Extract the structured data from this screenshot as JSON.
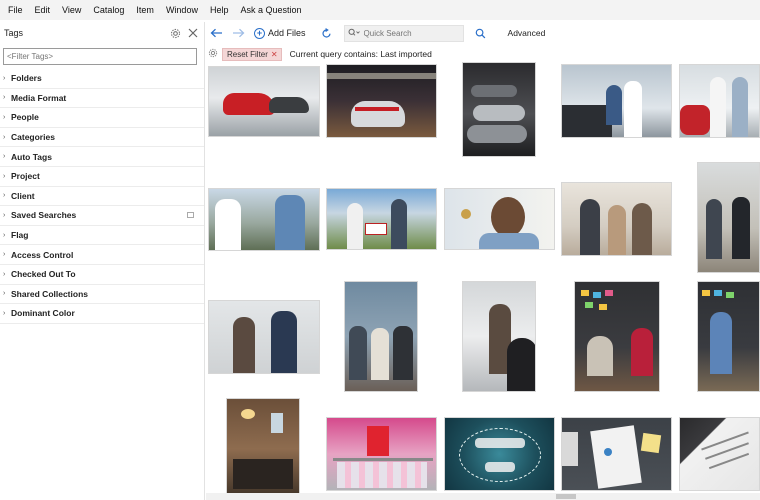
{
  "menu": [
    "File",
    "Edit",
    "View",
    "Catalog",
    "Item",
    "Window",
    "Help",
    "Ask a Question"
  ],
  "sidebar": {
    "title": "Tags",
    "filter_placeholder": "<Filter Tags>",
    "items": [
      {
        "label": "Folders"
      },
      {
        "label": "Media Format"
      },
      {
        "label": "People"
      },
      {
        "label": "Categories"
      },
      {
        "label": "Auto Tags"
      },
      {
        "label": "Project"
      },
      {
        "label": "Client"
      },
      {
        "label": "Saved Searches"
      },
      {
        "label": "Flag"
      },
      {
        "label": "Access Control"
      },
      {
        "label": "Checked Out To"
      },
      {
        "label": "Shared Collections"
      },
      {
        "label": "Dominant Color"
      }
    ]
  },
  "toolbar": {
    "add_files_label": "Add Files",
    "search_placeholder": "Quick Search",
    "advanced_label": "Advanced"
  },
  "filter": {
    "reset_label": "Reset Filter",
    "query_text": "Current query contains: Last imported"
  },
  "thumbnails": [
    {
      "subject": "red sports car in showroom"
    },
    {
      "subject": "cars in lit garage"
    },
    {
      "subject": "parked cars dark garage"
    },
    {
      "subject": "car dealer handshake"
    },
    {
      "subject": "car showroom meeting"
    },
    {
      "subject": "house sale handshake"
    },
    {
      "subject": "couple with sold sign"
    },
    {
      "subject": "man holding house key"
    },
    {
      "subject": "office handover of keys"
    },
    {
      "subject": "office meeting handshake"
    },
    {
      "subject": "business handshake"
    },
    {
      "subject": "team seated in office"
    },
    {
      "subject": "woman in office"
    },
    {
      "subject": "team at board with notes"
    },
    {
      "subject": "presenter at board"
    },
    {
      "subject": "cafe interior"
    },
    {
      "subject": "sale clothing rack"
    },
    {
      "subject": "summer sale sign"
    },
    {
      "subject": "charts on desk"
    },
    {
      "subject": "signing documents"
    }
  ],
  "colors": {
    "accent": "#2a6fc9",
    "chip": "#f4d6d6"
  }
}
